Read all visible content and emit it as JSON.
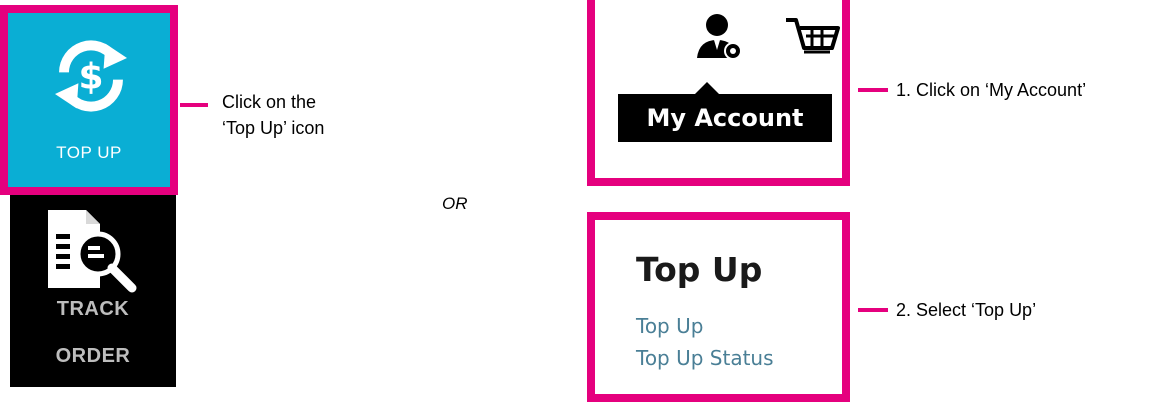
{
  "sidebar": {
    "topup_label": "TOP UP",
    "track_line1": "TRACK",
    "track_line2": "ORDER"
  },
  "callouts": {
    "topup_line1": "Click on the",
    "topup_line2": "‘Top Up’ icon",
    "or": "OR",
    "step1": "1. Click on ‘My Account’",
    "step2": "2. Select ‘Top Up’"
  },
  "header": {
    "my_account_tooltip": "My Account"
  },
  "menu": {
    "title": "Top Up",
    "links": [
      "Top Up",
      "Top Up Status"
    ]
  },
  "colors": {
    "highlight": "#e5007e",
    "topup_tile": "#0aaed4",
    "link": "#4a7f96"
  },
  "icons": {
    "topup": "currency-refresh-icon",
    "track": "document-search-icon",
    "account": "user-icon",
    "cart": "cart-icon"
  }
}
